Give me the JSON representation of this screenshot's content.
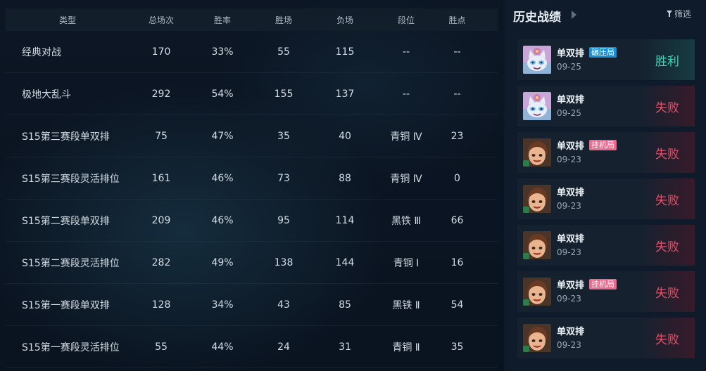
{
  "table": {
    "headers": [
      "类型",
      "总场次",
      "胜率",
      "胜场",
      "负场",
      "段位",
      "胜点"
    ],
    "rows": [
      [
        "经典对战",
        "170",
        "33%",
        "55",
        "115",
        "--",
        "--"
      ],
      [
        "极地大乱斗",
        "292",
        "54%",
        "155",
        "137",
        "--",
        "--"
      ],
      [
        "S15第三赛段单双排",
        "75",
        "47%",
        "35",
        "40",
        "青铜 Ⅳ",
        "23"
      ],
      [
        "S15第三赛段灵活排位",
        "161",
        "46%",
        "73",
        "88",
        "青铜 Ⅳ",
        "0"
      ],
      [
        "S15第二赛段单双排",
        "209",
        "46%",
        "95",
        "114",
        "黑铁 Ⅲ",
        "66"
      ],
      [
        "S15第二赛段灵活排位",
        "282",
        "49%",
        "138",
        "144",
        "青铜 Ⅰ",
        "16"
      ],
      [
        "S15第一赛段单双排",
        "128",
        "34%",
        "43",
        "85",
        "黑铁 Ⅱ",
        "54"
      ],
      [
        "S15第一赛段灵活排位",
        "55",
        "44%",
        "24",
        "31",
        "青铜 Ⅱ",
        "35"
      ]
    ]
  },
  "history": {
    "title": "历史战绩",
    "filter_label": "筛选",
    "matches": [
      {
        "mode": "单双排",
        "tag": "碾压局",
        "tag_color": "blue",
        "date": "09-25",
        "result": "胜利",
        "win": true,
        "champion": "cat-icon"
      },
      {
        "mode": "单双排",
        "tag": "",
        "tag_color": "",
        "date": "09-25",
        "result": "失败",
        "win": false,
        "champion": "cat-icon"
      },
      {
        "mode": "单双排",
        "tag": "挂机局",
        "tag_color": "pink",
        "date": "09-23",
        "result": "失败",
        "win": false,
        "champion": "girl-icon"
      },
      {
        "mode": "单双排",
        "tag": "",
        "tag_color": "",
        "date": "09-23",
        "result": "失败",
        "win": false,
        "champion": "girl-icon"
      },
      {
        "mode": "单双排",
        "tag": "",
        "tag_color": "",
        "date": "09-23",
        "result": "失败",
        "win": false,
        "champion": "girl-icon"
      },
      {
        "mode": "单双排",
        "tag": "挂机局",
        "tag_color": "pink",
        "date": "09-23",
        "result": "失败",
        "win": false,
        "champion": "girl-icon"
      },
      {
        "mode": "单双排",
        "tag": "",
        "tag_color": "",
        "date": "09-23",
        "result": "失败",
        "win": false,
        "champion": "girl-icon"
      }
    ]
  },
  "colors": {
    "win": "#3fd6b8",
    "lose": "#e5506a",
    "tag_blue": "#1c8fd0",
    "tag_pink": "#e86a8c"
  }
}
